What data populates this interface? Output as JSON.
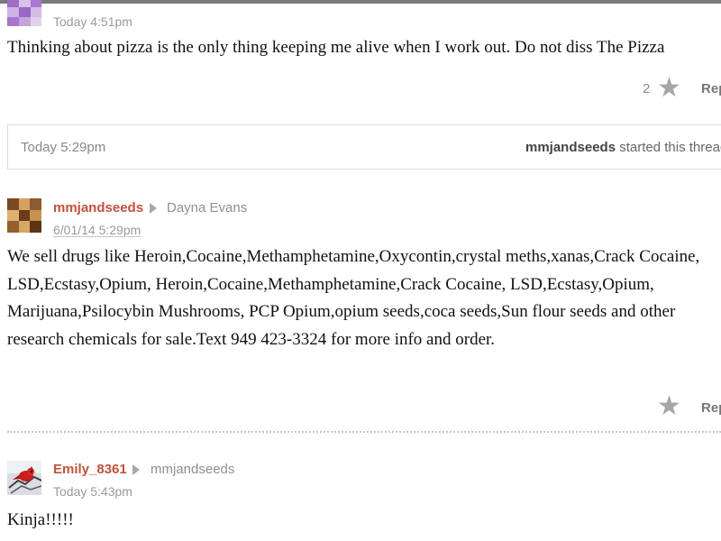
{
  "comment_top": {
    "timestamp": "Today 4:51pm",
    "body": "Thinking about pizza is the only thing keeping me alive when I work out. Do not diss The Pizza",
    "star_count": "2",
    "reply_label": "Reply",
    "avatar_icon": "purple-pixel-avatar-icon"
  },
  "thread_header": {
    "time": "Today 5:29pm",
    "starter_user": "mmjandseeds",
    "starter_suffix": "started this thread"
  },
  "comment_spam": {
    "username": "mmjandseeds",
    "reply_to": "Dayna Evans",
    "timestamp": "6/01/14 5:29pm",
    "body": "We sell drugs like Heroin,Cocaine,Methamphetamine,Oxycontin,crystal meths,xanas,Crack Cocaine, LSD,Ecstasy,Opium, Heroin,Cocaine,Methamphetamine,Crack Cocaine, LSD,Ecstasy,Opium, Marijuana,Psilocybin Mushrooms, PCP Opium,opium seeds,coca seeds,Sun flour seeds and other research chemicals for sale.Text 949 423-3324 for more info and order.",
    "reply_label": "Reply",
    "avatar_icon": "brown-pixel-avatar-icon"
  },
  "comment_reply": {
    "username": "Emily_8361",
    "reply_to": "mmjandseeds",
    "timestamp": "Today 5:43pm",
    "body": "Kinja!!!!!",
    "avatar_icon": "cardinal-bird-avatar-icon"
  },
  "colors": {
    "username": "#c0523b",
    "meta_gray": "#9a9a9a",
    "star_gray": "#a6a6a6"
  }
}
